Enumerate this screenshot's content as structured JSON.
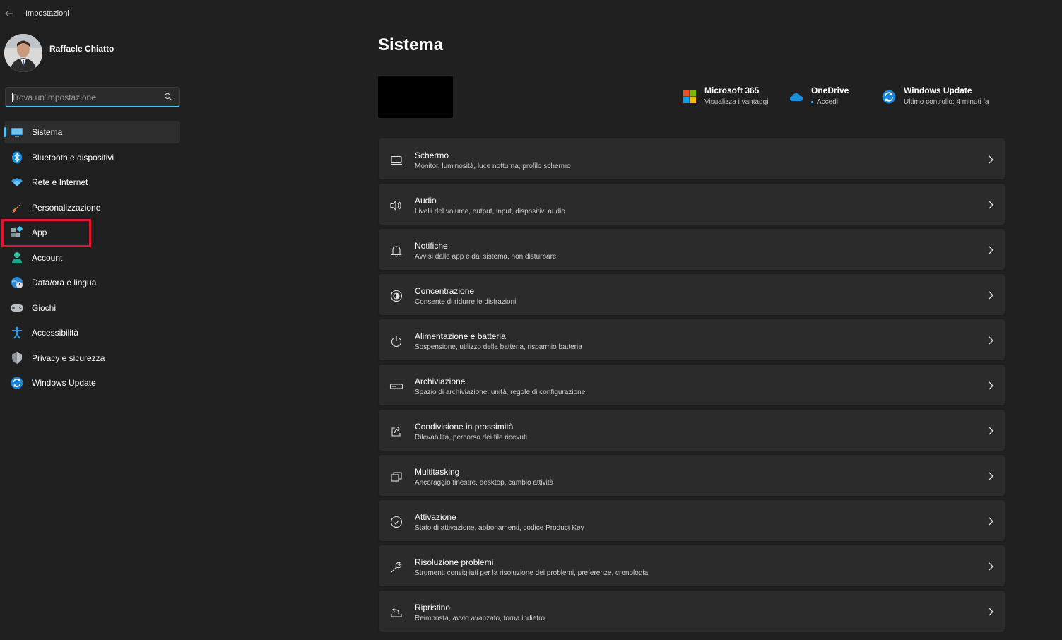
{
  "window": {
    "title": "Impostazioni"
  },
  "profile": {
    "name": "Raffaele Chiatto"
  },
  "search": {
    "placeholder": "Trova un'impostazione",
    "value": ""
  },
  "sidebar": {
    "items": [
      {
        "label": "Sistema",
        "icon": "monitor-icon",
        "active": true
      },
      {
        "label": "Bluetooth e dispositivi",
        "icon": "bluetooth-icon"
      },
      {
        "label": "Rete e Internet",
        "icon": "wifi-icon"
      },
      {
        "label": "Personalizzazione",
        "icon": "paintbrush-icon"
      },
      {
        "label": "App",
        "icon": "apps-icon",
        "highlighted": true
      },
      {
        "label": "Account",
        "icon": "person-icon"
      },
      {
        "label": "Data/ora e lingua",
        "icon": "globe-clock-icon"
      },
      {
        "label": "Giochi",
        "icon": "gamepad-icon"
      },
      {
        "label": "Accessibilità",
        "icon": "accessibility-icon"
      },
      {
        "label": "Privacy e sicurezza",
        "icon": "shield-icon"
      },
      {
        "label": "Windows Update",
        "icon": "update-icon"
      }
    ]
  },
  "main": {
    "title": "Sistema",
    "quick_links": [
      {
        "title": "Microsoft 365",
        "subtitle": "Visualizza i vantaggi",
        "icon": "microsoft-logo-icon"
      },
      {
        "title": "OneDrive",
        "subtitle": "Accedi",
        "icon": "cloud-icon"
      },
      {
        "title": "Windows Update",
        "subtitle": "Ultimo controllo: 4 minuti fa",
        "icon": "update-icon"
      }
    ],
    "cards": [
      {
        "title": "Schermo",
        "subtitle": "Monitor, luminosità, luce notturna, profilo schermo",
        "icon": "display-icon"
      },
      {
        "title": "Audio",
        "subtitle": "Livelli del volume, output, input, dispositivi audio",
        "icon": "speaker-icon"
      },
      {
        "title": "Notifiche",
        "subtitle": "Avvisi dalle app e dal sistema, non disturbare",
        "icon": "bell-icon"
      },
      {
        "title": "Concentrazione",
        "subtitle": "Consente di ridurre le distrazioni",
        "icon": "focus-icon"
      },
      {
        "title": "Alimentazione e batteria",
        "subtitle": "Sospensione, utilizzo della batteria, risparmio batteria",
        "icon": "power-icon"
      },
      {
        "title": "Archiviazione",
        "subtitle": "Spazio di archiviazione, unità, regole di configurazione",
        "icon": "storage-icon"
      },
      {
        "title": "Condivisione in prossimità",
        "subtitle": "Rilevabilità, percorso dei file ricevuti",
        "icon": "share-icon"
      },
      {
        "title": "Multitasking",
        "subtitle": "Ancoraggio finestre, desktop, cambio attività",
        "icon": "multitasking-icon"
      },
      {
        "title": "Attivazione",
        "subtitle": "Stato di attivazione, abbonamenti, codice Product Key",
        "icon": "check-circle-icon"
      },
      {
        "title": "Risoluzione problemi",
        "subtitle": "Strumenti consigliati per la risoluzione dei problemi, preferenze, cronologia",
        "icon": "wrench-icon"
      },
      {
        "title": "Ripristino",
        "subtitle": "Reimposta, avvio avanzato, torna indietro",
        "icon": "recovery-icon"
      }
    ]
  },
  "colors": {
    "accent": "#4cc2ff",
    "highlight": "#e3152e",
    "background": "#202020",
    "card": "#2b2b2b"
  }
}
